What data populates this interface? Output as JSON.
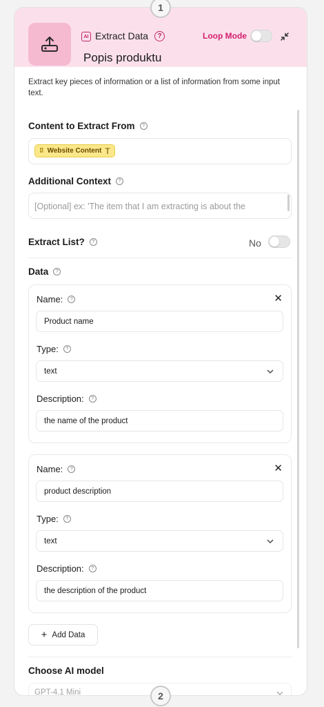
{
  "steps": {
    "top": "1",
    "bottom": "2"
  },
  "node": {
    "badge": "AI",
    "type_label": "Extract Data",
    "help": "?",
    "loop_label": "Loop Mode",
    "title": "Popis produktu",
    "description": "Extract key pieces of information or a list of information from some input text."
  },
  "content_section": {
    "label": "Content to Extract From",
    "chip": "Website Content"
  },
  "context_section": {
    "label": "Additional Context",
    "placeholder": "[Optional] ex: 'The item that I am extracting is about the"
  },
  "extract_list": {
    "label": "Extract List?",
    "value": "No"
  },
  "data_section": {
    "label": "Data",
    "items": [
      {
        "name_label": "Name:",
        "name_value": "Product name",
        "type_label": "Type:",
        "type_value": "text",
        "description_label": "Description:",
        "description_value": "the name of the product"
      },
      {
        "name_label": "Name:",
        "name_value": "product description",
        "type_label": "Type:",
        "type_value": "text",
        "description_label": "Description:",
        "description_value": "the description of the product"
      }
    ],
    "add_label": "Add Data"
  },
  "model_section": {
    "label": "Choose AI model",
    "value": "GPT-4.1 Mini"
  },
  "colors": {
    "header_bg": "#fbe0eb",
    "accent": "#d41d6e",
    "chip_bg": "#fbe88a"
  }
}
